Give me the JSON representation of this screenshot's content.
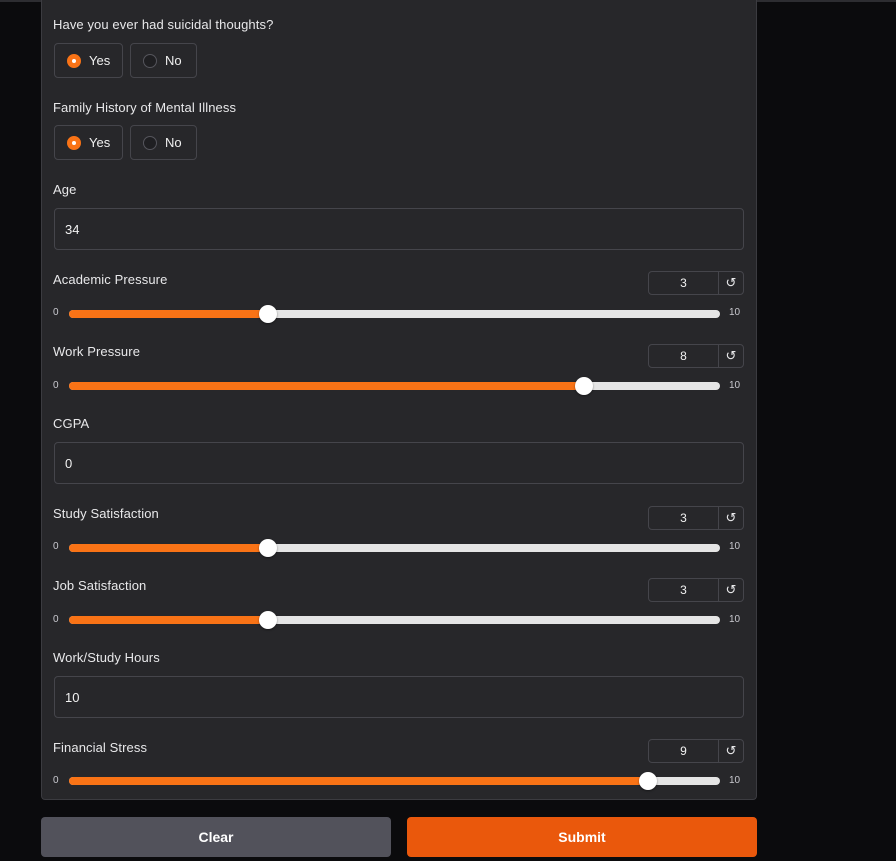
{
  "suicidal": {
    "label": "Have you ever had suicidal thoughts?",
    "options": [
      "Yes",
      "No"
    ],
    "selected": "Yes"
  },
  "family_history": {
    "label": "Family History of Mental Illness",
    "options": [
      "Yes",
      "No"
    ],
    "selected": "Yes"
  },
  "age": {
    "label": "Age",
    "value": "34"
  },
  "academic_pressure": {
    "label": "Academic Pressure",
    "value": "3",
    "min": "0",
    "max": "10"
  },
  "work_pressure": {
    "label": "Work Pressure",
    "value": "8",
    "min": "0",
    "max": "10"
  },
  "cgpa": {
    "label": "CGPA",
    "value": "0"
  },
  "study_satisfaction": {
    "label": "Study Satisfaction",
    "value": "3",
    "min": "0",
    "max": "10"
  },
  "job_satisfaction": {
    "label": "Job Satisfaction",
    "value": "3",
    "min": "0",
    "max": "10"
  },
  "work_study_hours": {
    "label": "Work/Study Hours",
    "value": "10"
  },
  "financial_stress": {
    "label": "Financial Stress",
    "value": "9",
    "min": "0",
    "max": "10"
  },
  "reset_icon": "↺",
  "buttons": {
    "clear": "Clear",
    "submit": "Submit"
  },
  "colors": {
    "accent": "#f97316",
    "submit": "#ea580c",
    "clear": "#52525b",
    "panel": "#27272a",
    "background": "#0b0b0d"
  }
}
